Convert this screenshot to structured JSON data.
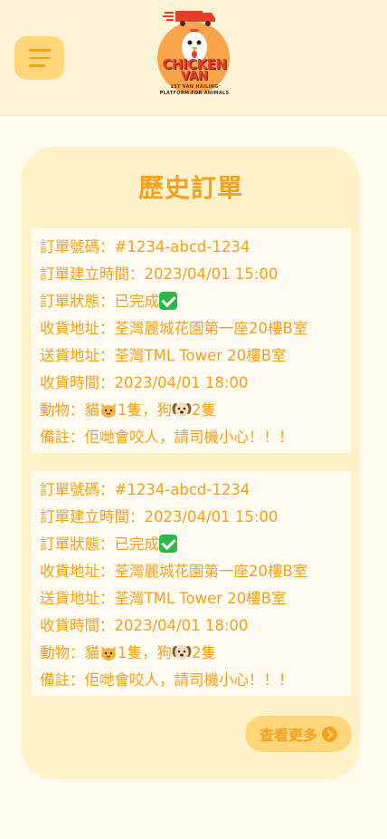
{
  "header": {
    "logo": {
      "line1": "CHICKEN",
      "line2": "VAN",
      "tagline1": "1ST VAN HAILING",
      "tagline2": "PLATFORM FOR ANIMALS"
    }
  },
  "page_title": "歷史訂單",
  "orders": [
    {
      "order_no": "訂單號碼：#1234-abcd-1234",
      "created": "訂單建立時間：2023/04/01 15:00",
      "status_prefix": "訂單狀態：已完成",
      "pickup": "收貨地址：荃灣麗城花園第一座20樓B室",
      "dropoff": "送貨地址：荃灣TML Tower 20樓B室",
      "pickup_time": "收貨時間：2023/04/01 18:00",
      "animals_a": "動物：貓",
      "animals_b": "1隻，狗",
      "animals_c": "2隻",
      "note": "備註：佢哋會咬人，請司機小心！！！"
    },
    {
      "order_no": "訂單號碼：#1234-abcd-1234",
      "created": "訂單建立時間：2023/04/01 15:00",
      "status_prefix": "訂單狀態：已完成",
      "pickup": "收貨地址：荃灣麗城花園第一座20樓B室",
      "dropoff": "送貨地址：荃灣TML Tower 20樓B室",
      "pickup_time": "收貨時間：2023/04/01 18:00",
      "animals_a": "動物：貓",
      "animals_b": "1隻，狗",
      "animals_c": "2隻",
      "note": "備註：佢哋會咬人，請司機小心！！！"
    }
  ],
  "more_button": {
    "label": "查看更多",
    "icon": "chevron-right-circle-icon"
  },
  "icons": {
    "menu": "hamburger-menu-icon",
    "status": "check-mark-icon",
    "cat": "cat-face-icon",
    "dog": "dog-face-icon"
  },
  "colors": {
    "accent": "#f4a020",
    "button_bg": "#ffd77a",
    "card_bg": "#fff1c8",
    "header_bg": "#fff3d6",
    "page_bg": "#fffaeb",
    "check": "#2fb84a"
  }
}
